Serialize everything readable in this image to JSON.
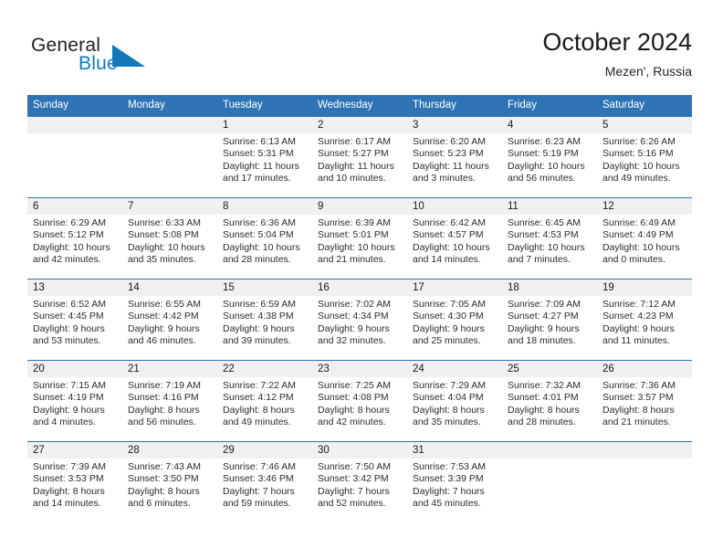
{
  "brand": {
    "name_part1": "General",
    "name_part2": "Blue",
    "logo_icon": "blue-triangle-flag-icon"
  },
  "header": {
    "title": "October 2024",
    "subtitle": "Mezen', Russia"
  },
  "colors": {
    "header_blue": "#2e74b5",
    "band_gray": "#f0f0f0",
    "brand_blue": "#1278b8",
    "text_dark": "#1a1a1a"
  },
  "calendar": {
    "weekday_headers": [
      "Sunday",
      "Monday",
      "Tuesday",
      "Wednesday",
      "Thursday",
      "Friday",
      "Saturday"
    ],
    "weeks": [
      [
        {
          "day": "",
          "sunrise": "",
          "sunset": "",
          "daylight_line1": "",
          "daylight_line2": ""
        },
        {
          "day": "",
          "sunrise": "",
          "sunset": "",
          "daylight_line1": "",
          "daylight_line2": ""
        },
        {
          "day": "1",
          "sunrise": "Sunrise: 6:13 AM",
          "sunset": "Sunset: 5:31 PM",
          "daylight_line1": "Daylight: 11 hours",
          "daylight_line2": "and 17 minutes."
        },
        {
          "day": "2",
          "sunrise": "Sunrise: 6:17 AM",
          "sunset": "Sunset: 5:27 PM",
          "daylight_line1": "Daylight: 11 hours",
          "daylight_line2": "and 10 minutes."
        },
        {
          "day": "3",
          "sunrise": "Sunrise: 6:20 AM",
          "sunset": "Sunset: 5:23 PM",
          "daylight_line1": "Daylight: 11 hours",
          "daylight_line2": "and 3 minutes."
        },
        {
          "day": "4",
          "sunrise": "Sunrise: 6:23 AM",
          "sunset": "Sunset: 5:19 PM",
          "daylight_line1": "Daylight: 10 hours",
          "daylight_line2": "and 56 minutes."
        },
        {
          "day": "5",
          "sunrise": "Sunrise: 6:26 AM",
          "sunset": "Sunset: 5:16 PM",
          "daylight_line1": "Daylight: 10 hours",
          "daylight_line2": "and 49 minutes."
        }
      ],
      [
        {
          "day": "6",
          "sunrise": "Sunrise: 6:29 AM",
          "sunset": "Sunset: 5:12 PM",
          "daylight_line1": "Daylight: 10 hours",
          "daylight_line2": "and 42 minutes."
        },
        {
          "day": "7",
          "sunrise": "Sunrise: 6:33 AM",
          "sunset": "Sunset: 5:08 PM",
          "daylight_line1": "Daylight: 10 hours",
          "daylight_line2": "and 35 minutes."
        },
        {
          "day": "8",
          "sunrise": "Sunrise: 6:36 AM",
          "sunset": "Sunset: 5:04 PM",
          "daylight_line1": "Daylight: 10 hours",
          "daylight_line2": "and 28 minutes."
        },
        {
          "day": "9",
          "sunrise": "Sunrise: 6:39 AM",
          "sunset": "Sunset: 5:01 PM",
          "daylight_line1": "Daylight: 10 hours",
          "daylight_line2": "and 21 minutes."
        },
        {
          "day": "10",
          "sunrise": "Sunrise: 6:42 AM",
          "sunset": "Sunset: 4:57 PM",
          "daylight_line1": "Daylight: 10 hours",
          "daylight_line2": "and 14 minutes."
        },
        {
          "day": "11",
          "sunrise": "Sunrise: 6:45 AM",
          "sunset": "Sunset: 4:53 PM",
          "daylight_line1": "Daylight: 10 hours",
          "daylight_line2": "and 7 minutes."
        },
        {
          "day": "12",
          "sunrise": "Sunrise: 6:49 AM",
          "sunset": "Sunset: 4:49 PM",
          "daylight_line1": "Daylight: 10 hours",
          "daylight_line2": "and 0 minutes."
        }
      ],
      [
        {
          "day": "13",
          "sunrise": "Sunrise: 6:52 AM",
          "sunset": "Sunset: 4:45 PM",
          "daylight_line1": "Daylight: 9 hours",
          "daylight_line2": "and 53 minutes."
        },
        {
          "day": "14",
          "sunrise": "Sunrise: 6:55 AM",
          "sunset": "Sunset: 4:42 PM",
          "daylight_line1": "Daylight: 9 hours",
          "daylight_line2": "and 46 minutes."
        },
        {
          "day": "15",
          "sunrise": "Sunrise: 6:59 AM",
          "sunset": "Sunset: 4:38 PM",
          "daylight_line1": "Daylight: 9 hours",
          "daylight_line2": "and 39 minutes."
        },
        {
          "day": "16",
          "sunrise": "Sunrise: 7:02 AM",
          "sunset": "Sunset: 4:34 PM",
          "daylight_line1": "Daylight: 9 hours",
          "daylight_line2": "and 32 minutes."
        },
        {
          "day": "17",
          "sunrise": "Sunrise: 7:05 AM",
          "sunset": "Sunset: 4:30 PM",
          "daylight_line1": "Daylight: 9 hours",
          "daylight_line2": "and 25 minutes."
        },
        {
          "day": "18",
          "sunrise": "Sunrise: 7:09 AM",
          "sunset": "Sunset: 4:27 PM",
          "daylight_line1": "Daylight: 9 hours",
          "daylight_line2": "and 18 minutes."
        },
        {
          "day": "19",
          "sunrise": "Sunrise: 7:12 AM",
          "sunset": "Sunset: 4:23 PM",
          "daylight_line1": "Daylight: 9 hours",
          "daylight_line2": "and 11 minutes."
        }
      ],
      [
        {
          "day": "20",
          "sunrise": "Sunrise: 7:15 AM",
          "sunset": "Sunset: 4:19 PM",
          "daylight_line1": "Daylight: 9 hours",
          "daylight_line2": "and 4 minutes."
        },
        {
          "day": "21",
          "sunrise": "Sunrise: 7:19 AM",
          "sunset": "Sunset: 4:16 PM",
          "daylight_line1": "Daylight: 8 hours",
          "daylight_line2": "and 56 minutes."
        },
        {
          "day": "22",
          "sunrise": "Sunrise: 7:22 AM",
          "sunset": "Sunset: 4:12 PM",
          "daylight_line1": "Daylight: 8 hours",
          "daylight_line2": "and 49 minutes."
        },
        {
          "day": "23",
          "sunrise": "Sunrise: 7:25 AM",
          "sunset": "Sunset: 4:08 PM",
          "daylight_line1": "Daylight: 8 hours",
          "daylight_line2": "and 42 minutes."
        },
        {
          "day": "24",
          "sunrise": "Sunrise: 7:29 AM",
          "sunset": "Sunset: 4:04 PM",
          "daylight_line1": "Daylight: 8 hours",
          "daylight_line2": "and 35 minutes."
        },
        {
          "day": "25",
          "sunrise": "Sunrise: 7:32 AM",
          "sunset": "Sunset: 4:01 PM",
          "daylight_line1": "Daylight: 8 hours",
          "daylight_line2": "and 28 minutes."
        },
        {
          "day": "26",
          "sunrise": "Sunrise: 7:36 AM",
          "sunset": "Sunset: 3:57 PM",
          "daylight_line1": "Daylight: 8 hours",
          "daylight_line2": "and 21 minutes."
        }
      ],
      [
        {
          "day": "27",
          "sunrise": "Sunrise: 7:39 AM",
          "sunset": "Sunset: 3:53 PM",
          "daylight_line1": "Daylight: 8 hours",
          "daylight_line2": "and 14 minutes."
        },
        {
          "day": "28",
          "sunrise": "Sunrise: 7:43 AM",
          "sunset": "Sunset: 3:50 PM",
          "daylight_line1": "Daylight: 8 hours",
          "daylight_line2": "and 6 minutes."
        },
        {
          "day": "29",
          "sunrise": "Sunrise: 7:46 AM",
          "sunset": "Sunset: 3:46 PM",
          "daylight_line1": "Daylight: 7 hours",
          "daylight_line2": "and 59 minutes."
        },
        {
          "day": "30",
          "sunrise": "Sunrise: 7:50 AM",
          "sunset": "Sunset: 3:42 PM",
          "daylight_line1": "Daylight: 7 hours",
          "daylight_line2": "and 52 minutes."
        },
        {
          "day": "31",
          "sunrise": "Sunrise: 7:53 AM",
          "sunset": "Sunset: 3:39 PM",
          "daylight_line1": "Daylight: 7 hours",
          "daylight_line2": "and 45 minutes."
        },
        {
          "day": "",
          "sunrise": "",
          "sunset": "",
          "daylight_line1": "",
          "daylight_line2": ""
        },
        {
          "day": "",
          "sunrise": "",
          "sunset": "",
          "daylight_line1": "",
          "daylight_line2": ""
        }
      ]
    ]
  }
}
